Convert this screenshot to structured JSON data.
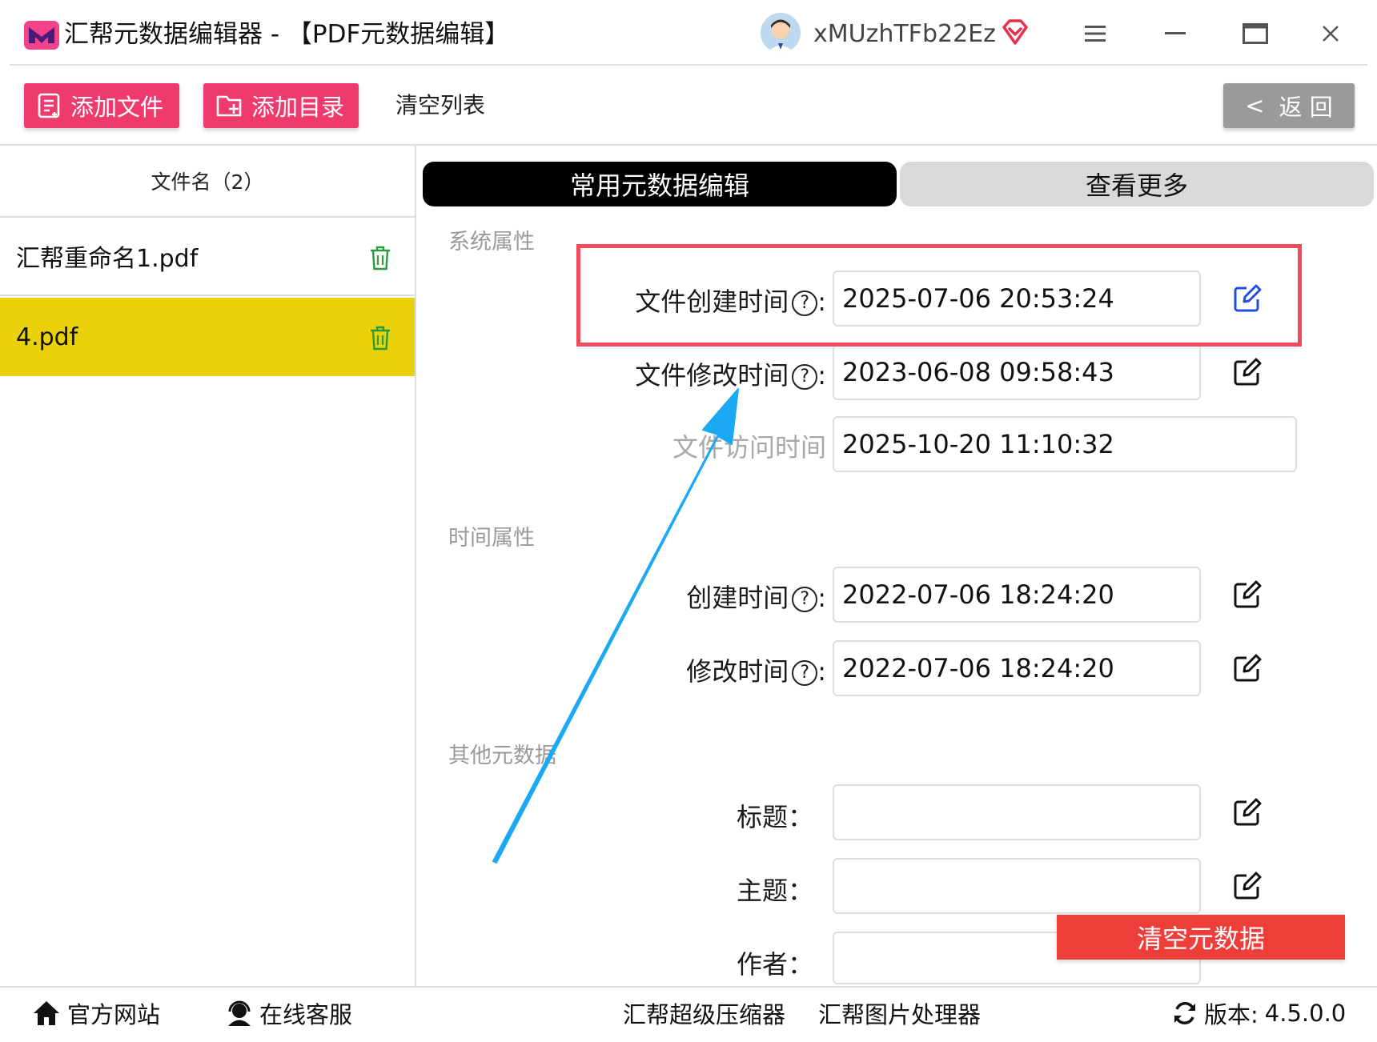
{
  "window": {
    "title": "汇帮元数据编辑器 - 【PDF元数据编辑】",
    "username": "xMUzhTFb22Ez"
  },
  "toolbar": {
    "add_file": "添加文件",
    "add_folder": "添加目录",
    "clear_list": "清空列表",
    "back": "返 回",
    "back_arrow": "<"
  },
  "file_list": {
    "header": "文件名（2）",
    "items": [
      {
        "name": "汇帮重命名1.pdf",
        "selected": false
      },
      {
        "name": "4.pdf",
        "selected": true
      }
    ]
  },
  "tabs": [
    {
      "label": "常用元数据编辑",
      "active": true
    },
    {
      "label": "查看更多",
      "active": false
    }
  ],
  "sections": {
    "system": {
      "title": "系统属性",
      "fields": [
        {
          "label": "文件创建时间",
          "value": "2025-07-06 20:53:24"
        },
        {
          "label": "文件修改时间",
          "value": "2023-06-08 09:58:43"
        },
        {
          "label": "文件访问时间",
          "value": "2025-10-20 11:10:32"
        }
      ]
    },
    "time": {
      "title": "时间属性",
      "fields": [
        {
          "label": "创建时间",
          "value": "2022-07-06 18:24:20"
        },
        {
          "label": "修改时间",
          "value": "2022-07-06 18:24:20"
        }
      ]
    },
    "other": {
      "title": "其他元数据",
      "fields": [
        {
          "label": "标题",
          "value": ""
        },
        {
          "label": "主题",
          "value": ""
        },
        {
          "label": "作者",
          "value": ""
        }
      ]
    }
  },
  "clear_metadata": "清空元数据",
  "footer": {
    "website": "官方网站",
    "support": "在线客服",
    "compressor": "汇帮超级压缩器",
    "image_tool": "汇帮图片处理器",
    "version_label": "版本:",
    "version": "4.5.0.0"
  },
  "colors": {
    "pink": "#ee3a6d",
    "selected_row": "#ead20a",
    "highlight": "#ef4b5a",
    "arrow": "#1aa9f2",
    "clear_button": "#ee3e3a",
    "active_tab": "#000000",
    "inactive_tab": "#d9d9d9"
  }
}
